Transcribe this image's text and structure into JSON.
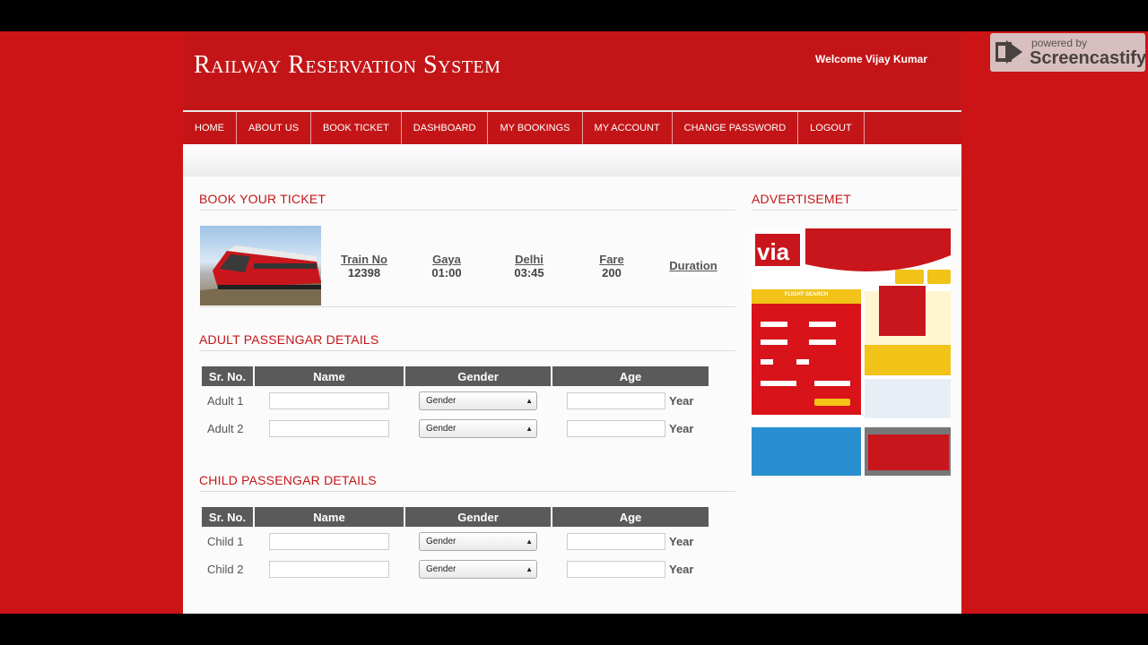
{
  "header": {
    "title": "Railway Reservation System",
    "welcome": "Welcome Vijay Kumar"
  },
  "nav": [
    "HOME",
    "ABOUT US",
    "BOOK TICKET",
    "DASHBOARD",
    "MY BOOKINGS",
    "MY ACCOUNT",
    "CHANGE PASSWORD",
    "LOGOUT"
  ],
  "book": {
    "heading": "BOOK YOUR TICKET",
    "train_no_label": "Train No",
    "train_no": "12398",
    "from_label": "Gaya",
    "from_time": "01:00",
    "to_label": "Delhi",
    "to_time": "03:45",
    "fare_label": "Fare",
    "fare": "200",
    "duration_label": "Duration"
  },
  "ad": {
    "heading": "ADVERTISEMET",
    "brand": "via",
    "flight_search": "FLIGHT SEARCH"
  },
  "adult": {
    "heading": "ADULT PASSENGAR DETAILS",
    "columns": [
      "Sr. No.",
      "Name",
      "Gender",
      "Age"
    ],
    "rows": [
      {
        "label": "Adult 1",
        "gender": "Gender",
        "year": "Year"
      },
      {
        "label": "Adult 2",
        "gender": "Gender",
        "year": "Year"
      }
    ]
  },
  "child": {
    "heading": "CHILD PASSENGAR DETAILS",
    "columns": [
      "Sr. No.",
      "Name",
      "Gender",
      "Age"
    ],
    "rows": [
      {
        "label": "Child 1",
        "gender": "Gender",
        "year": "Year"
      },
      {
        "label": "Child 2",
        "gender": "Gender",
        "year": "Year"
      }
    ]
  },
  "overlay": {
    "line1": "powered by",
    "line2": "Screencastify"
  }
}
